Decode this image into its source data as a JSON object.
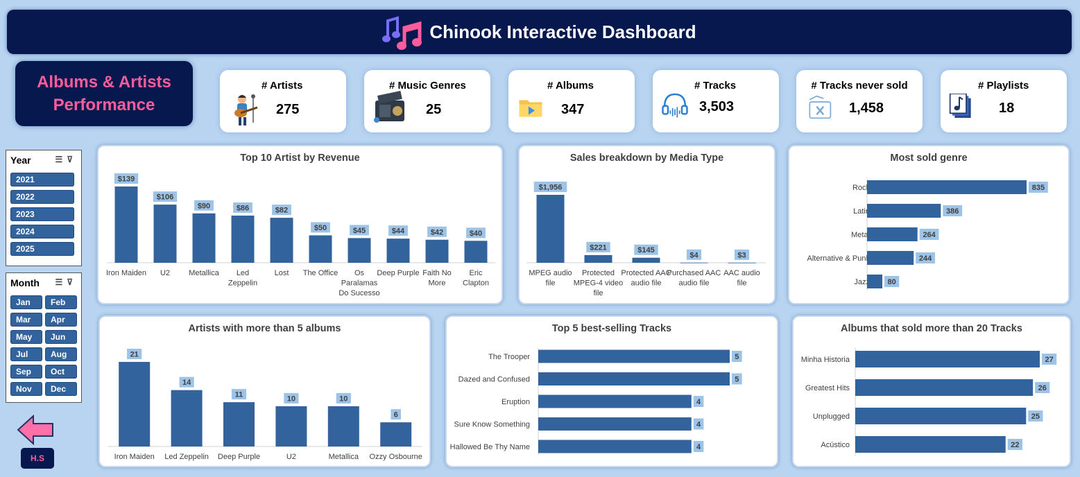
{
  "header": {
    "title": "Chinook Interactive Dashboard"
  },
  "section": {
    "line1": "Albums & Artists",
    "line2": "Performance"
  },
  "kpis": [
    {
      "label": "# Artists",
      "value": "275",
      "icon": "guitar-player-icon"
    },
    {
      "label": "# Music Genres",
      "value": "25",
      "icon": "radio-icon"
    },
    {
      "label": "# Albums",
      "value": "347",
      "icon": "media-folder-icon"
    },
    {
      "label": "# Tracks",
      "value": "3,503",
      "icon": "headphones-icon"
    },
    {
      "label": "# Tracks never sold",
      "value": "1,458",
      "icon": "no-music-icon"
    },
    {
      "label": "# Playlists",
      "value": "18",
      "icon": "playlist-icon"
    }
  ],
  "slicers": {
    "year": {
      "title": "Year",
      "items": [
        "2021",
        "2022",
        "2023",
        "2024",
        "2025"
      ]
    },
    "month": {
      "title": "Month",
      "items": [
        "Jan",
        "Feb",
        "Mar",
        "Apr",
        "May",
        "Jun",
        "Jul",
        "Aug",
        "Sep",
        "Oct",
        "Nov",
        "Dec"
      ]
    }
  },
  "footer": {
    "hs_label": "H.S"
  },
  "colors": {
    "bar": "#33639c",
    "label_bg": "#9dc3e6",
    "header": "#06184e",
    "accent_pink": "#ff5c9b"
  },
  "chart_data": [
    {
      "id": "top10",
      "type": "bar",
      "title": "Top 10 Artist by Revenue",
      "categories": [
        "Iron Maiden",
        "U2",
        "Metallica",
        "Led Zeppelin",
        "Lost",
        "The Office",
        "Os Paralamas Do Sucesso",
        "Deep Purple",
        "Faith No More",
        "Eric Clapton"
      ],
      "values": [
        139,
        106,
        90,
        86,
        82,
        50,
        45,
        44,
        42,
        40
      ],
      "labels": [
        "$139",
        "$106",
        "$90",
        "$86",
        "$82",
        "$50",
        "$45",
        "$44",
        "$42",
        "$40"
      ]
    },
    {
      "id": "media",
      "type": "bar",
      "title": "Sales breakdown by Media Type",
      "categories": [
        "MPEG audio file",
        "Protected MPEG-4 video file",
        "Protected AAC audio file",
        "Purchased AAC audio file",
        "AAC audio file"
      ],
      "values": [
        1956,
        221,
        145,
        4,
        3
      ],
      "labels": [
        "$1,956",
        "$221",
        "$145",
        "$4",
        "$3"
      ]
    },
    {
      "id": "genre",
      "type": "bar",
      "orientation": "horizontal",
      "title": "Most sold genre",
      "categories": [
        "Rock",
        "Latin",
        "Metal",
        "Alternative & Punk",
        "Jazz"
      ],
      "values": [
        835,
        386,
        264,
        244,
        80
      ],
      "labels": [
        "835",
        "386",
        "264",
        "244",
        "80"
      ]
    },
    {
      "id": "artists5",
      "type": "bar",
      "title": "Artists with more than 5 albums",
      "categories": [
        "Iron Maiden",
        "Led Zeppelin",
        "Deep Purple",
        "U2",
        "Metallica",
        "Ozzy Osbourne"
      ],
      "values": [
        21,
        14,
        11,
        10,
        10,
        6
      ],
      "labels": [
        "21",
        "14",
        "11",
        "10",
        "10",
        "6"
      ]
    },
    {
      "id": "tracks",
      "type": "bar",
      "orientation": "horizontal",
      "title": "Top 5 best-selling Tracks",
      "categories": [
        "The Trooper",
        "Dazed and Confused",
        "Eruption",
        "Sure Know Something",
        "Hallowed Be Thy Name"
      ],
      "values": [
        5,
        5,
        4,
        4,
        4
      ],
      "labels": [
        "5",
        "5",
        "4",
        "4",
        "4"
      ]
    },
    {
      "id": "albums20",
      "type": "bar",
      "orientation": "horizontal",
      "title": "Albums that sold more than 20 Tracks",
      "categories": [
        "Minha Historia",
        "Greatest Hits",
        "Unplugged",
        "Acústico"
      ],
      "values": [
        27,
        26,
        25,
        22
      ],
      "labels": [
        "27",
        "26",
        "25",
        "22"
      ]
    }
  ]
}
